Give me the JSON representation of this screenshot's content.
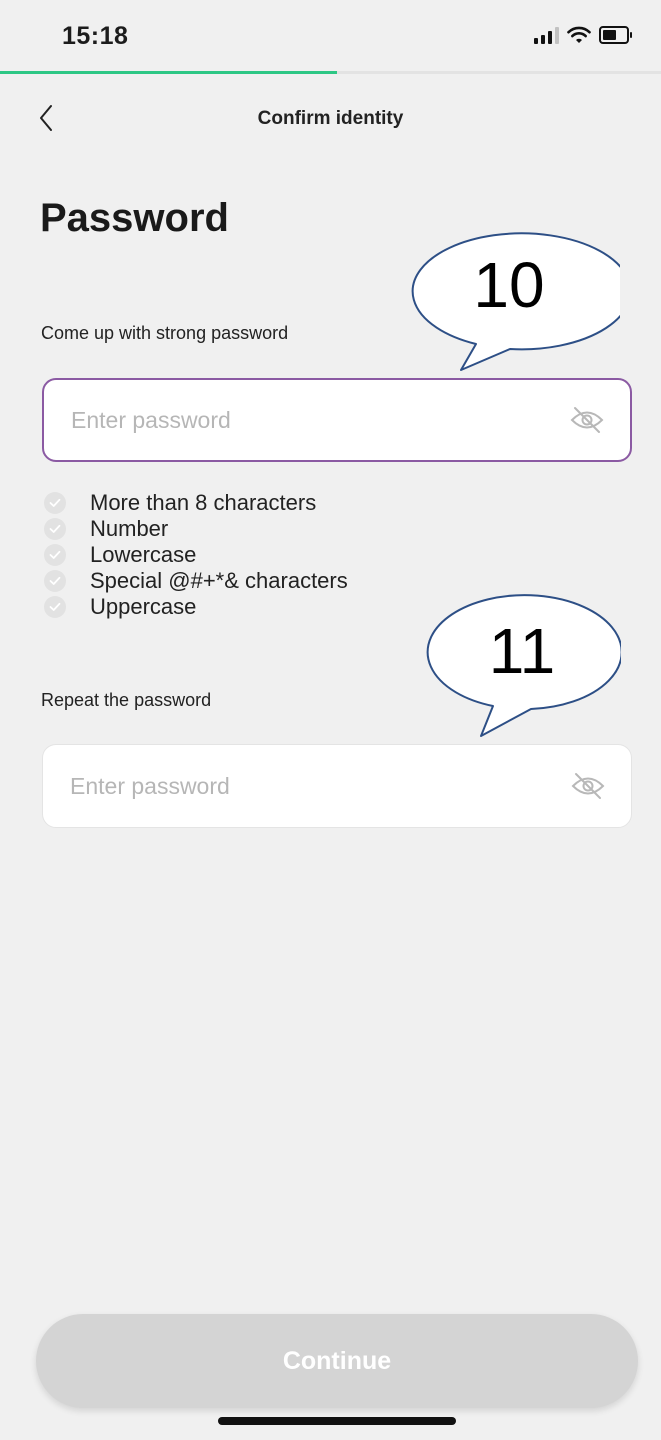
{
  "status_bar": {
    "time": "15:18",
    "icons": [
      "signal-icon",
      "wifi-icon",
      "battery-icon"
    ]
  },
  "progress": {
    "fraction": 0.51,
    "color": "#2dc785"
  },
  "nav": {
    "back_icon": "chevron-left-icon",
    "title": "Confirm identity"
  },
  "page": {
    "heading": "Password"
  },
  "password_field": {
    "label": "Come up with strong password",
    "value": "",
    "placeholder": "Enter password",
    "icon": "eye-off-icon",
    "focus_color": "#8b5aa3"
  },
  "requirements": [
    {
      "label": "More than 8 characters",
      "met": false
    },
    {
      "label": "Number",
      "met": false
    },
    {
      "label": "Lowercase",
      "met": false
    },
    {
      "label": "Special @#+*& characters",
      "met": false
    },
    {
      "label": "Uppercase",
      "met": false
    }
  ],
  "repeat_field": {
    "label": "Repeat the password",
    "value": "",
    "placeholder": "Enter password",
    "icon": "eye-off-icon"
  },
  "annotations": [
    {
      "label": "10"
    },
    {
      "label": "11"
    }
  ],
  "footer": {
    "continue_label": "Continue",
    "disabled_color": "#d4d4d4"
  }
}
